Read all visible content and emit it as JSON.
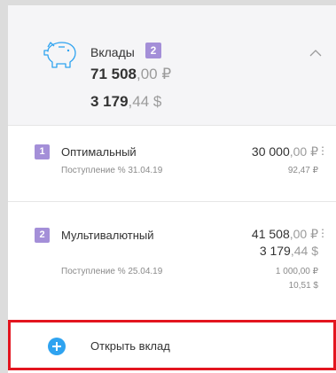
{
  "summary": {
    "title": "Вклады",
    "count": "2",
    "total_rub_int": "71 508",
    "total_rub_frac": ",00 ₽",
    "total_usd_int": "3 179",
    "total_usd_frac": ",44 $"
  },
  "deposits": [
    {
      "index": "1",
      "name": "Оптимальный",
      "income_label": "Поступление % 31.04.19",
      "amount_int": "30 000",
      "amount_frac": ",00 ₽",
      "income_amount": "92,47 ₽"
    },
    {
      "index": "2",
      "name": "Мультивалютный",
      "income_label": "Поступление % 25.04.19",
      "amount_rub_int": "41 508",
      "amount_rub_frac": ",00 ₽",
      "amount_usd_int": "3 179",
      "amount_usd_frac": ",44 $",
      "income_rub": "1 000,00 ₽",
      "income_usd": "10,51 $"
    }
  ],
  "actions": {
    "open_deposit_label": "Открыть вклад"
  },
  "colors": {
    "badge": "#a48fd8",
    "header_bg": "#f5f5f7",
    "accent_plus": "#2fa3f0",
    "highlight_border": "#e3151f"
  },
  "icons": {
    "summary": "piggy-bank-icon",
    "collapse": "chevron-up-icon",
    "more": "more-vertical-icon",
    "add": "plus-circle-icon"
  }
}
